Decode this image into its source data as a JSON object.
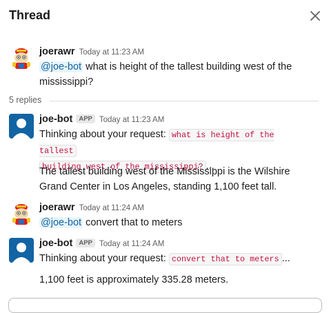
{
  "header": {
    "title": "Thread",
    "close_icon": "close-icon"
  },
  "colors": {
    "mention_text": "#1264a3",
    "code_text": "#c01343",
    "link_bg": "#e8f5fa"
  },
  "thread": {
    "replies_label": "5 replies",
    "messages": [
      {
        "author": "joerawr",
        "time": "Today at 11:23 AM",
        "avatar": "robot-mascot-avatar",
        "mention": "@joe-bot",
        "text": " what is height of the tallest building west of the mississippi?"
      },
      {
        "author": "joe-bot",
        "badge": "APP",
        "time": "Today at 11:23 AM",
        "avatar": "default-user-avatar",
        "thinking_prefix": "Thinking about your request: ",
        "code_line1": "what is height of the tallest",
        "code_line2": "building west of the mississippi?",
        "ellipsis": "...",
        "answer": "The tallest building west of the Mississippi is the Wilshire Grand Center in Los Angeles, standing 1,100 feet tall."
      },
      {
        "author": "joerawr",
        "time": "Today at 11:24 AM",
        "avatar": "robot-mascot-avatar",
        "mention": "@joe-bot",
        "text": " convert that to meters"
      },
      {
        "author": "joe-bot",
        "badge": "APP",
        "time": "Today at 11:24 AM",
        "avatar": "default-user-avatar",
        "thinking_prefix": "Thinking about your request: ",
        "code": "convert that to meters",
        "ellipsis": "...",
        "answer": "1,100 feet is approximately 335.28 meters."
      }
    ]
  }
}
